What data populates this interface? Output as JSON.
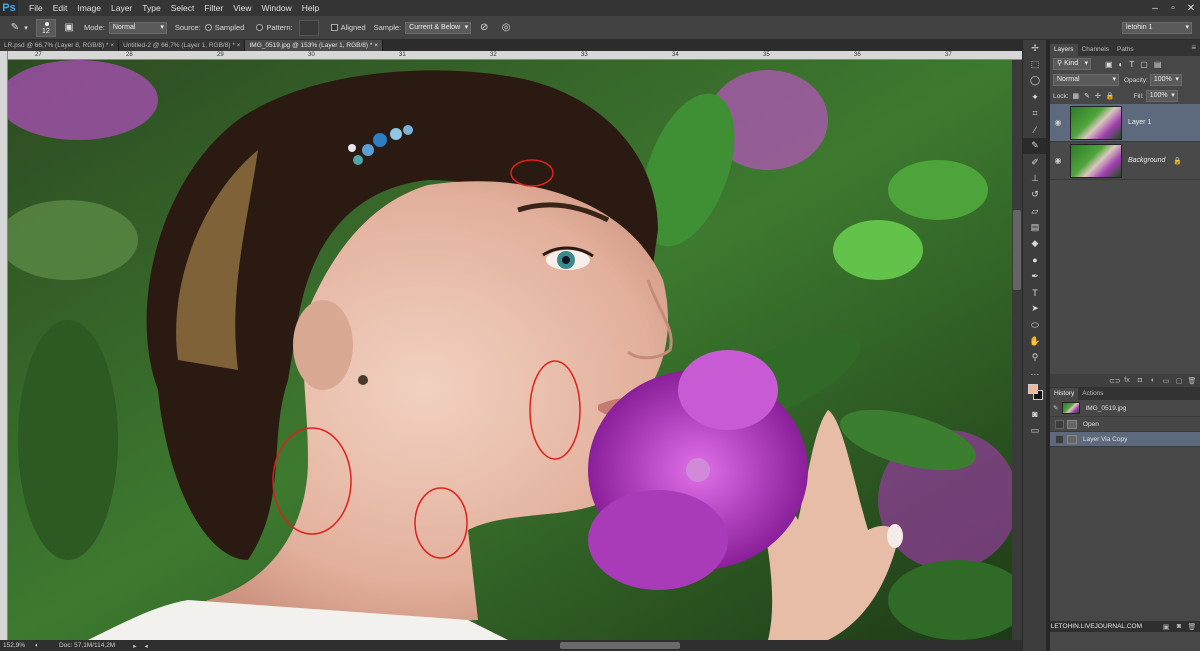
{
  "app": {
    "logo": "Ps",
    "accent": "#3fa9f5"
  },
  "menu": [
    "File",
    "Edit",
    "Image",
    "Layer",
    "Type",
    "Select",
    "Filter",
    "View",
    "Window",
    "Help"
  ],
  "window_controls": [
    "minimize",
    "restore",
    "close"
  ],
  "options": {
    "brush_size": "12",
    "mode_label": "Mode:",
    "mode_value": "Normal",
    "source_label": "Source:",
    "sampled_label": "Sampled",
    "pattern_label": "Pattern:",
    "aligned_label": "Aligned",
    "sample_label": "Sample:",
    "sample_value": "Current & Below",
    "workspace": "letohin 1"
  },
  "tabs": [
    {
      "label": "LR.psd @ 66,7% (Layer 8, RGB/8) *",
      "active": false
    },
    {
      "label": "Untitled-2 @ 66,7% (Layer 1, RGB/8) *",
      "active": false
    },
    {
      "label": "IMG_0519.jpg @ 153% (Layer 1, RGB/8) *",
      "active": true
    }
  ],
  "ruler_top": [
    "27",
    "28",
    "29",
    "30",
    "31",
    "32",
    "33",
    "34",
    "35",
    "36",
    "37"
  ],
  "status": {
    "zoom": "152,9%",
    "doc": "Doc: 57,1M/114,2M",
    "watermark": "LETOHIN.LIVEJOURNAL.COM"
  },
  "layers_panel": {
    "tabs": [
      "Layers",
      "Channels",
      "Paths"
    ],
    "kind": "Kind",
    "blend": "Normal",
    "opacity_label": "Opacity:",
    "opacity": "100%",
    "lock_label": "Lock:",
    "fill_label": "Fill:",
    "fill": "100%",
    "layers": [
      {
        "name": "Layer 1",
        "selected": true,
        "italic": false
      },
      {
        "name": "Background",
        "selected": false,
        "italic": true
      }
    ]
  },
  "history_panel": {
    "tabs": [
      "History",
      "Actions"
    ],
    "snapshot": "IMG_0519.jpg",
    "items": [
      {
        "name": "Open",
        "selected": false
      },
      {
        "name": "Layer Via Copy",
        "selected": true
      }
    ]
  },
  "colors": {
    "foreground": "#f0b79a",
    "background": "#111111",
    "markup": "#e0201c"
  }
}
